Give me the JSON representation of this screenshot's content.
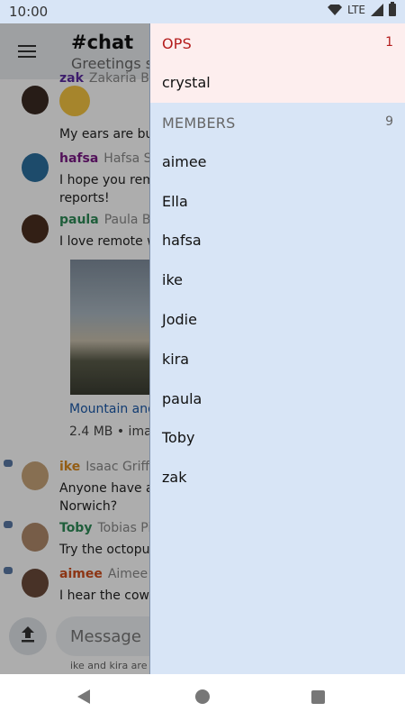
{
  "status": {
    "time": "10:00",
    "network": "LTE"
  },
  "chat": {
    "title": "#chat",
    "subtitle": "Greetings s",
    "messages": [
      {
        "nick": "zak",
        "real": "Zakaria Bu",
        "text": "My ears are bu",
        "color": "#5b2ca0"
      },
      {
        "nick": "hafsa",
        "real": "Hafsa Sa",
        "text": "I hope you rem reports!",
        "color": "#7a1a85"
      },
      {
        "nick": "paula",
        "real": "Paula Br",
        "text": "I love remote w",
        "color": "#2e8b57"
      },
      {
        "nick": "ike",
        "real": "Isaac Griffi",
        "text": "Anyone have an Norwich?",
        "color": "#d98a1e"
      },
      {
        "nick": "Toby",
        "real": "Tobias Pi",
        "text": "Try the octopus",
        "color": "#2e8b57"
      },
      {
        "nick": "aimee",
        "real": "Aimee S",
        "text": "I hear the cows",
        "color": "#cf4f1e"
      }
    ],
    "photo_link": "Mountain and",
    "photo_meta": "2.4 MB • imag",
    "composer_placeholder": "Message",
    "typing": "ike and kira are"
  },
  "drawer": {
    "ops_label": "OPS",
    "ops_count": "1",
    "ops": [
      "crystal"
    ],
    "members_label": "MEMBERS",
    "members_count": "9",
    "members": [
      "aimee",
      "Ella",
      "hafsa",
      "ike",
      "Jodie",
      "kira",
      "paula",
      "Toby",
      "zak"
    ]
  },
  "colors": {
    "drawer_bg": "#d8e5f6",
    "ops_bg": "#fdeeee",
    "ops_accent": "#b41c1c"
  }
}
